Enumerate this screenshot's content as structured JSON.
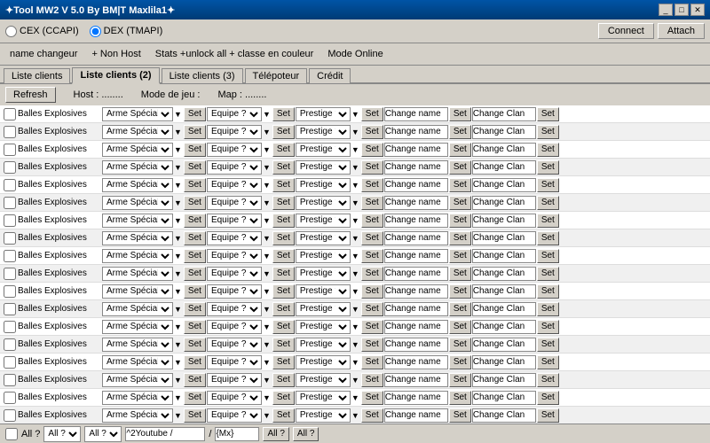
{
  "window": {
    "title": "✦Tool MW2 V 5.0  By BM|T Maxlila1✦",
    "min": "_",
    "max": "□",
    "close": "✕"
  },
  "radio": {
    "cex_label": "CEX (CCAPI)",
    "dex_label": "DEX (TMAPI)"
  },
  "buttons": {
    "connect": "Connect",
    "attach": "Attach"
  },
  "menu": {
    "items": [
      "name changeur",
      "+ Non Host",
      "Stats +unlock all + classe en couleur",
      "Mode Online",
      "Liste clients",
      "Liste clients (2)",
      "Liste clients (3)",
      "Télépoteur",
      "Crédit"
    ]
  },
  "content_header": {
    "refresh": "Refresh",
    "host_label": "Host :",
    "host_value": "........",
    "mode_label": "Mode de jeu :",
    "mode_value": "",
    "map_label": "Map :",
    "map_value": "........"
  },
  "active_tab": "Liste clients (2)",
  "rows": [
    {
      "label": "Balles Explosives"
    },
    {
      "label": "Balles Explosives"
    },
    {
      "label": "Balles Explosives"
    },
    {
      "label": "Balles Explosives"
    },
    {
      "label": "Balles Explosives"
    },
    {
      "label": "Balles Explosives"
    },
    {
      "label": "Balles Explosives"
    },
    {
      "label": "Balles Explosives"
    },
    {
      "label": "Balles Explosives"
    },
    {
      "label": "Balles Explosives"
    },
    {
      "label": "Balles Explosives"
    },
    {
      "label": "Balles Explosives"
    },
    {
      "label": "Balles Explosives"
    },
    {
      "label": "Balles Explosives"
    },
    {
      "label": "Balles Explosives"
    },
    {
      "label": "Balles Explosives"
    },
    {
      "label": "Balles Explosives"
    },
    {
      "label": "Balles Explosives"
    }
  ],
  "dropdowns": {
    "arme": "Arme Spécial ?",
    "equipe": "Equipe ?",
    "prestige": "Prestige ?",
    "change_name": "Change name",
    "change_clan": "Change Clan",
    "set": "Set"
  },
  "footer": {
    "all_label": "All ?",
    "all_select": "All ?",
    "all_select2": "All ?",
    "youtube_input": "^2Youtube /",
    "mx_input": "{Mx}",
    "all_btn": "All ?",
    "all_btn2": "All ?"
  }
}
